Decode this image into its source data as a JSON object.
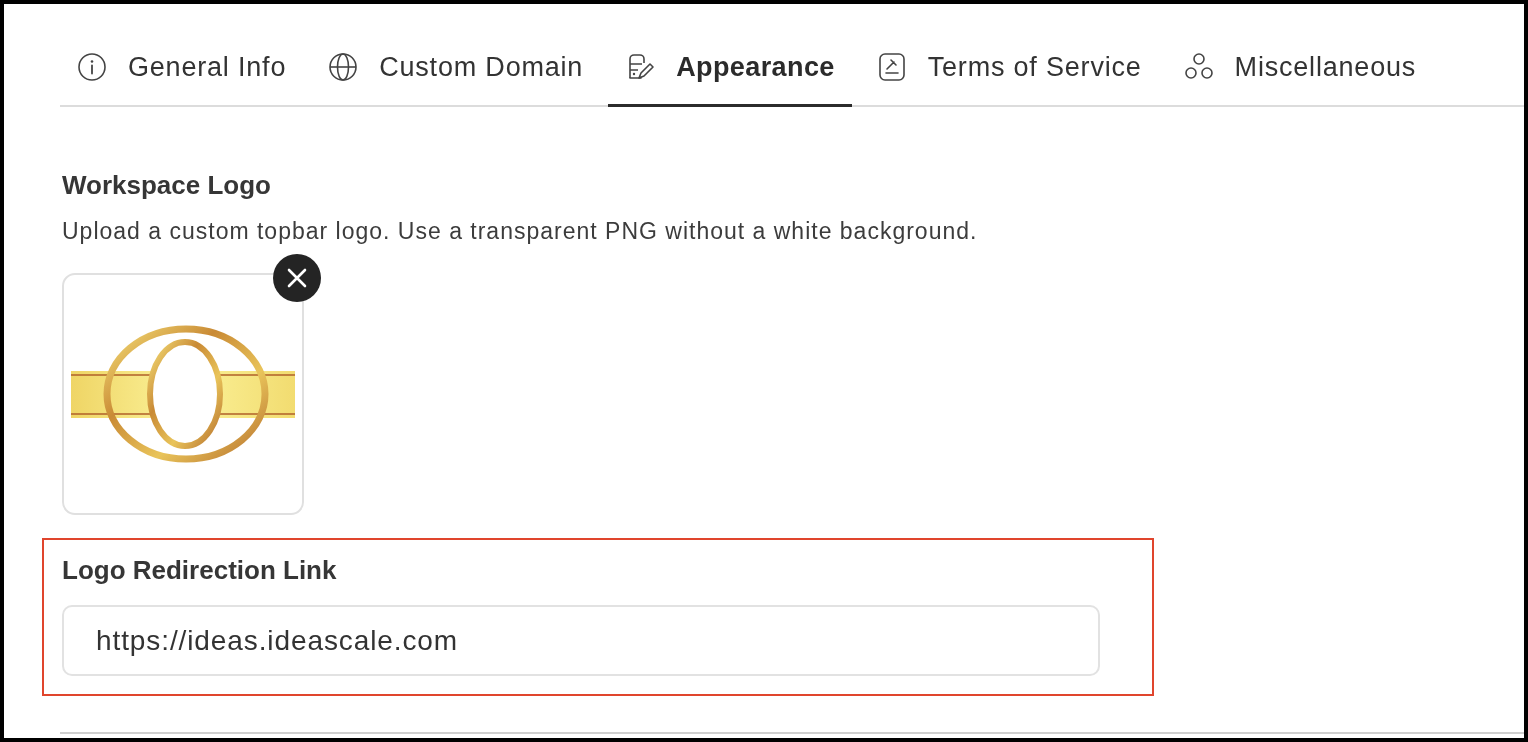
{
  "tabs": [
    {
      "label": "General Info",
      "selected": false
    },
    {
      "label": "Custom Domain",
      "selected": false
    },
    {
      "label": "Appearance",
      "selected": true
    },
    {
      "label": "Terms of Service",
      "selected": false
    },
    {
      "label": "Miscellaneous",
      "selected": false
    }
  ],
  "workspace_logo": {
    "title": "Workspace Logo",
    "description": "Upload a custom topbar logo. Use a transparent PNG without a white background."
  },
  "logo_redirection": {
    "label": "Logo Redirection Link",
    "value": "https://ideas.ideascale.com",
    "highlighted": true
  }
}
